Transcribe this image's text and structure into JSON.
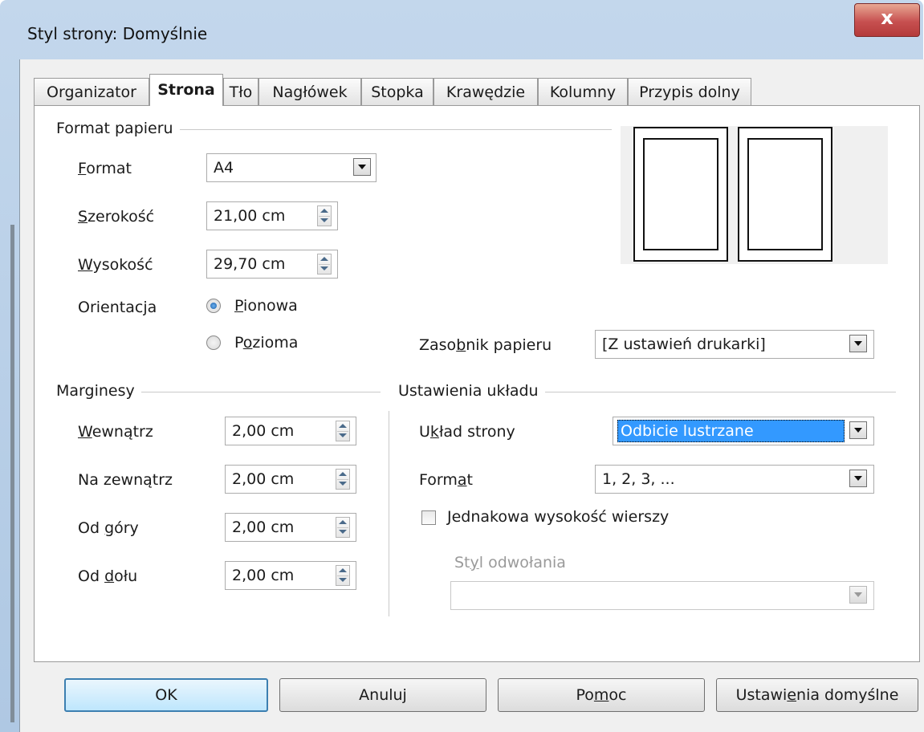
{
  "window": {
    "title": "Styl strony: Domyślnie",
    "close": "x"
  },
  "tabs": [
    {
      "label": "Organizator"
    },
    {
      "label": "Strona"
    },
    {
      "label": "Tło"
    },
    {
      "label": "Nagłówek"
    },
    {
      "label": "Stopka"
    },
    {
      "label": "Krawędzie"
    },
    {
      "label": "Kolumny"
    },
    {
      "label": "Przypis dolny"
    }
  ],
  "paper": {
    "group": "Format papieru",
    "format_label": "Format",
    "format_value": "A4",
    "width_label": "Szerokość",
    "width_value": "21,00 cm",
    "height_label": "Wysokość",
    "height_value": "29,70 cm",
    "orientation_label": "Orientacja",
    "portrait": "Pionowa",
    "landscape": "Pozioma",
    "tray_label": "Zasobnik papieru",
    "tray_value": "[Z ustawień drukarki]"
  },
  "margins": {
    "group": "Marginesy",
    "inner_label": "Wewnątrz",
    "inner_value": "2,00 cm",
    "outer_label": "Na zewnątrz",
    "outer_value": "2,00 cm",
    "top_label": "Od góry",
    "top_value": "2,00 cm",
    "bottom_label": "Od dołu",
    "bottom_value": "2,00 cm"
  },
  "layout": {
    "group": "Ustawienia układu",
    "page_layout_label": "Układ strony",
    "page_layout_value": "Odbicie lustrzane",
    "format_label": "Format",
    "format_value": "1, 2, 3, ...",
    "register_true": "Jednakowa wysokość wierszy",
    "ref_style_label": "Styl odwołania",
    "ref_style_value": ""
  },
  "buttons": {
    "ok": "OK",
    "cancel": "Anuluj",
    "help": "Pomoc",
    "reset": "Ustawienia domyślne"
  },
  "colors": {
    "accent": "#3399ff",
    "close": "#c75050",
    "frame": "#b8cfe7"
  }
}
